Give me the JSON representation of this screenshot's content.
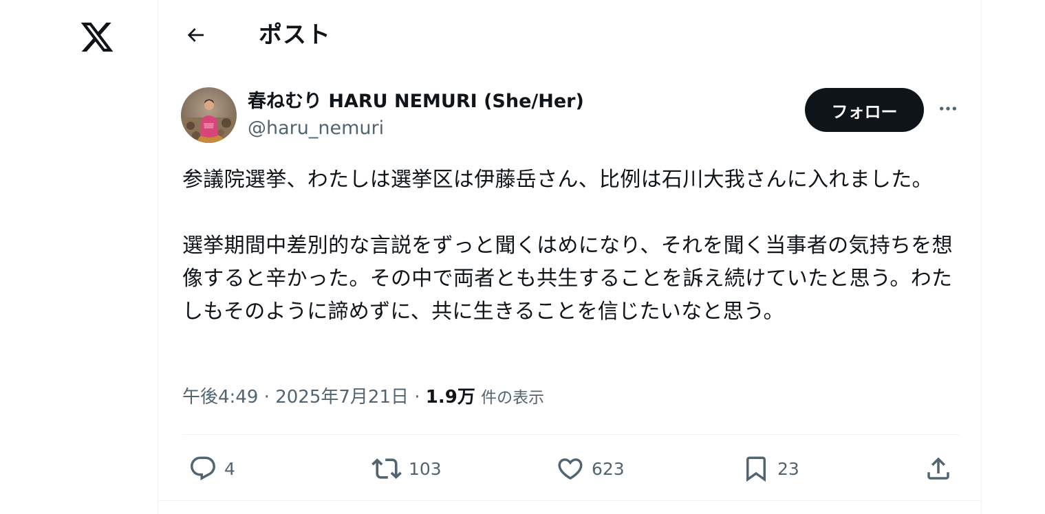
{
  "header": {
    "title": "ポスト"
  },
  "author": {
    "display_name": "春ねむり HARU NEMURI (She/Her)",
    "handle": "@haru_nemuri"
  },
  "follow_button": {
    "label": "フォロー"
  },
  "post": {
    "paragraphs": [
      "参議院選挙、わたしは選挙区は伊藤岳さん、比例は石川大我さんに入れました。",
      "選挙期間中差別的な言説をずっと聞くはめになり、それを聞く当事者の気持ちを想像すると辛かった。その中で両者とも共生することを訴え続けていたと思う。わたしもそのように諦めずに、共に生きることを信じたいなと思う。"
    ],
    "time": "午後4:49",
    "separator_1": "·",
    "date": "2025年7月21日",
    "separator_2": "·",
    "views_count": "1.9万",
    "views_label": "件の表示"
  },
  "actions": {
    "replies": "4",
    "reposts": "103",
    "likes": "623",
    "bookmarks": "23"
  },
  "icons": {
    "logo": "x-logo-icon",
    "back": "arrow-left-icon",
    "more": "more-horizontal-icon",
    "reply": "reply-icon",
    "repost": "repost-icon",
    "like": "heart-icon",
    "bookmark": "bookmark-icon",
    "share": "share-icon"
  },
  "colors": {
    "text": "#0f1419",
    "secondary_text": "#536471",
    "follow_button_bg": "#0f1419",
    "follow_button_text": "#ffffff",
    "divider": "#eff3f4"
  }
}
